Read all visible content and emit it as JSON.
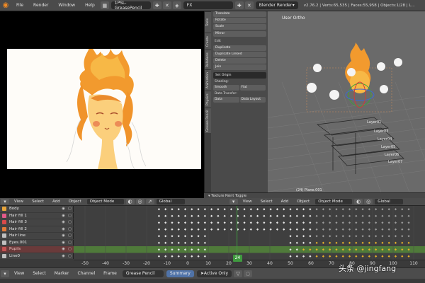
{
  "topbar": {
    "menus": [
      "File",
      "Render",
      "Window",
      "Help"
    ],
    "scene_file": "1PSL-GreasePencil",
    "scene": "FX",
    "render_engine": "Blender Render",
    "stats": "v2.76.2 | Verts:65,535 | Faces:55,958 | Objects:1/28 | L..."
  },
  "viewport": {
    "label": "User Ortho",
    "object_label": "(24) Plane.001",
    "bone_labels": [
      "Layer01",
      "Layer03",
      "Layer04",
      "Layer05",
      "Layer06",
      "Layer07"
    ]
  },
  "tool_shelf": {
    "tabs": [
      "Tools",
      "Create",
      "Relations",
      "Animation",
      "Physics",
      "Grease Pencil"
    ],
    "transform_items": [
      "Translate",
      "Rotate",
      "Scale",
      "Mirror"
    ],
    "edit_head": "Edit",
    "edit_items": [
      "Duplicate",
      "Duplicate Linked",
      "Delete",
      "Join"
    ],
    "set_origin": "Set Origin",
    "shading_head": "Shading:",
    "shading_options": [
      "Smooth",
      "Flat"
    ],
    "data_transfer_head": "Data Transfer:",
    "data_transfer_options": [
      "Data",
      "Data Layout"
    ],
    "bottom_caption": "Texture Paint Toggle"
  },
  "view3d_header": {
    "menus": [
      "View",
      "Select",
      "Add",
      "Object"
    ],
    "mode": "Object Mode",
    "orientation": "Global"
  },
  "dopesheet_header": {
    "menus": [
      "View",
      "Select",
      "Add",
      "Object"
    ],
    "mode": "Object Mode",
    "orientation": "Global"
  },
  "channels": [
    {
      "name": "Body",
      "color": "#e8a53a",
      "selected": false
    },
    {
      "name": "Hair fill 1",
      "color": "#e35a8a",
      "selected": false
    },
    {
      "name": "Hair fill 3",
      "color": "#d84a4a",
      "selected": false
    },
    {
      "name": "Hair fill 2",
      "color": "#e27a38",
      "selected": false
    },
    {
      "name": "Hair line",
      "color": "#c0c0c0",
      "selected": false
    },
    {
      "name": "Eyes.001",
      "color": "#c0c0c0",
      "selected": false
    },
    {
      "name": "Pupils",
      "color": "#c45252",
      "selected": true
    },
    {
      "name": "Line0",
      "color": "#c0c0c0",
      "selected": false
    }
  ],
  "timeline": {
    "ticks": [
      -50,
      -40,
      -30,
      -20,
      -10,
      0,
      10,
      20,
      30,
      40,
      50,
      60,
      70,
      80,
      90,
      100,
      110
    ],
    "current_frame": "24"
  },
  "bottom_toolbar": {
    "menus": [
      "View",
      "Select",
      "Marker",
      "Channel",
      "Frame"
    ],
    "mode": "Grease Pencil",
    "summary": "Summary",
    "active_only": "Active Only"
  },
  "watermark": "头条 @jingfang",
  "colors": {
    "accent_green": "#3f9a3f",
    "keyframe_yellow": "#e6b02a",
    "keyframe_white": "#e6e6e6"
  }
}
